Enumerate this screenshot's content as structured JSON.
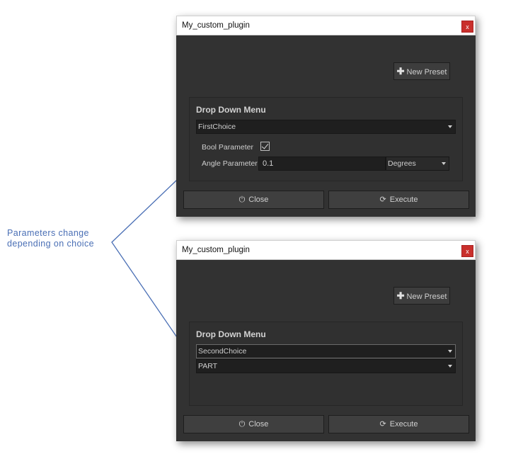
{
  "annotation": {
    "line1": "Parameters  change",
    "line2": "depending on choice"
  },
  "windows": [
    {
      "title": "My_custom_plugin",
      "close_label": "x",
      "new_preset_label": "New Preset",
      "group_title": "Drop Down Menu",
      "choice_value": "FirstChoice",
      "bool_label": "Bool Parameter",
      "bool_checked": true,
      "angle_label": "Angle Parameter",
      "angle_value": "0.1",
      "angle_unit": "Degrees",
      "close_button": "Close",
      "execute_button": "Execute"
    },
    {
      "title": "My_custom_plugin",
      "close_label": "x",
      "new_preset_label": "New Preset",
      "group_title": "Drop Down Menu",
      "choice_value": "SecondChoice",
      "part_value": "PART",
      "close_button": "Close",
      "execute_button": "Execute"
    }
  ],
  "icons": {
    "plus": "plus-icon",
    "power": "power-icon",
    "refresh": "refresh-icon",
    "check": "checkmark-icon",
    "dropdown": "chevron-down-icon"
  },
  "colors": {
    "window_bg": "#323232",
    "field_bg": "#1f1f1f",
    "close_red": "#c9302c",
    "annotation_blue": "#4a6fb5"
  }
}
